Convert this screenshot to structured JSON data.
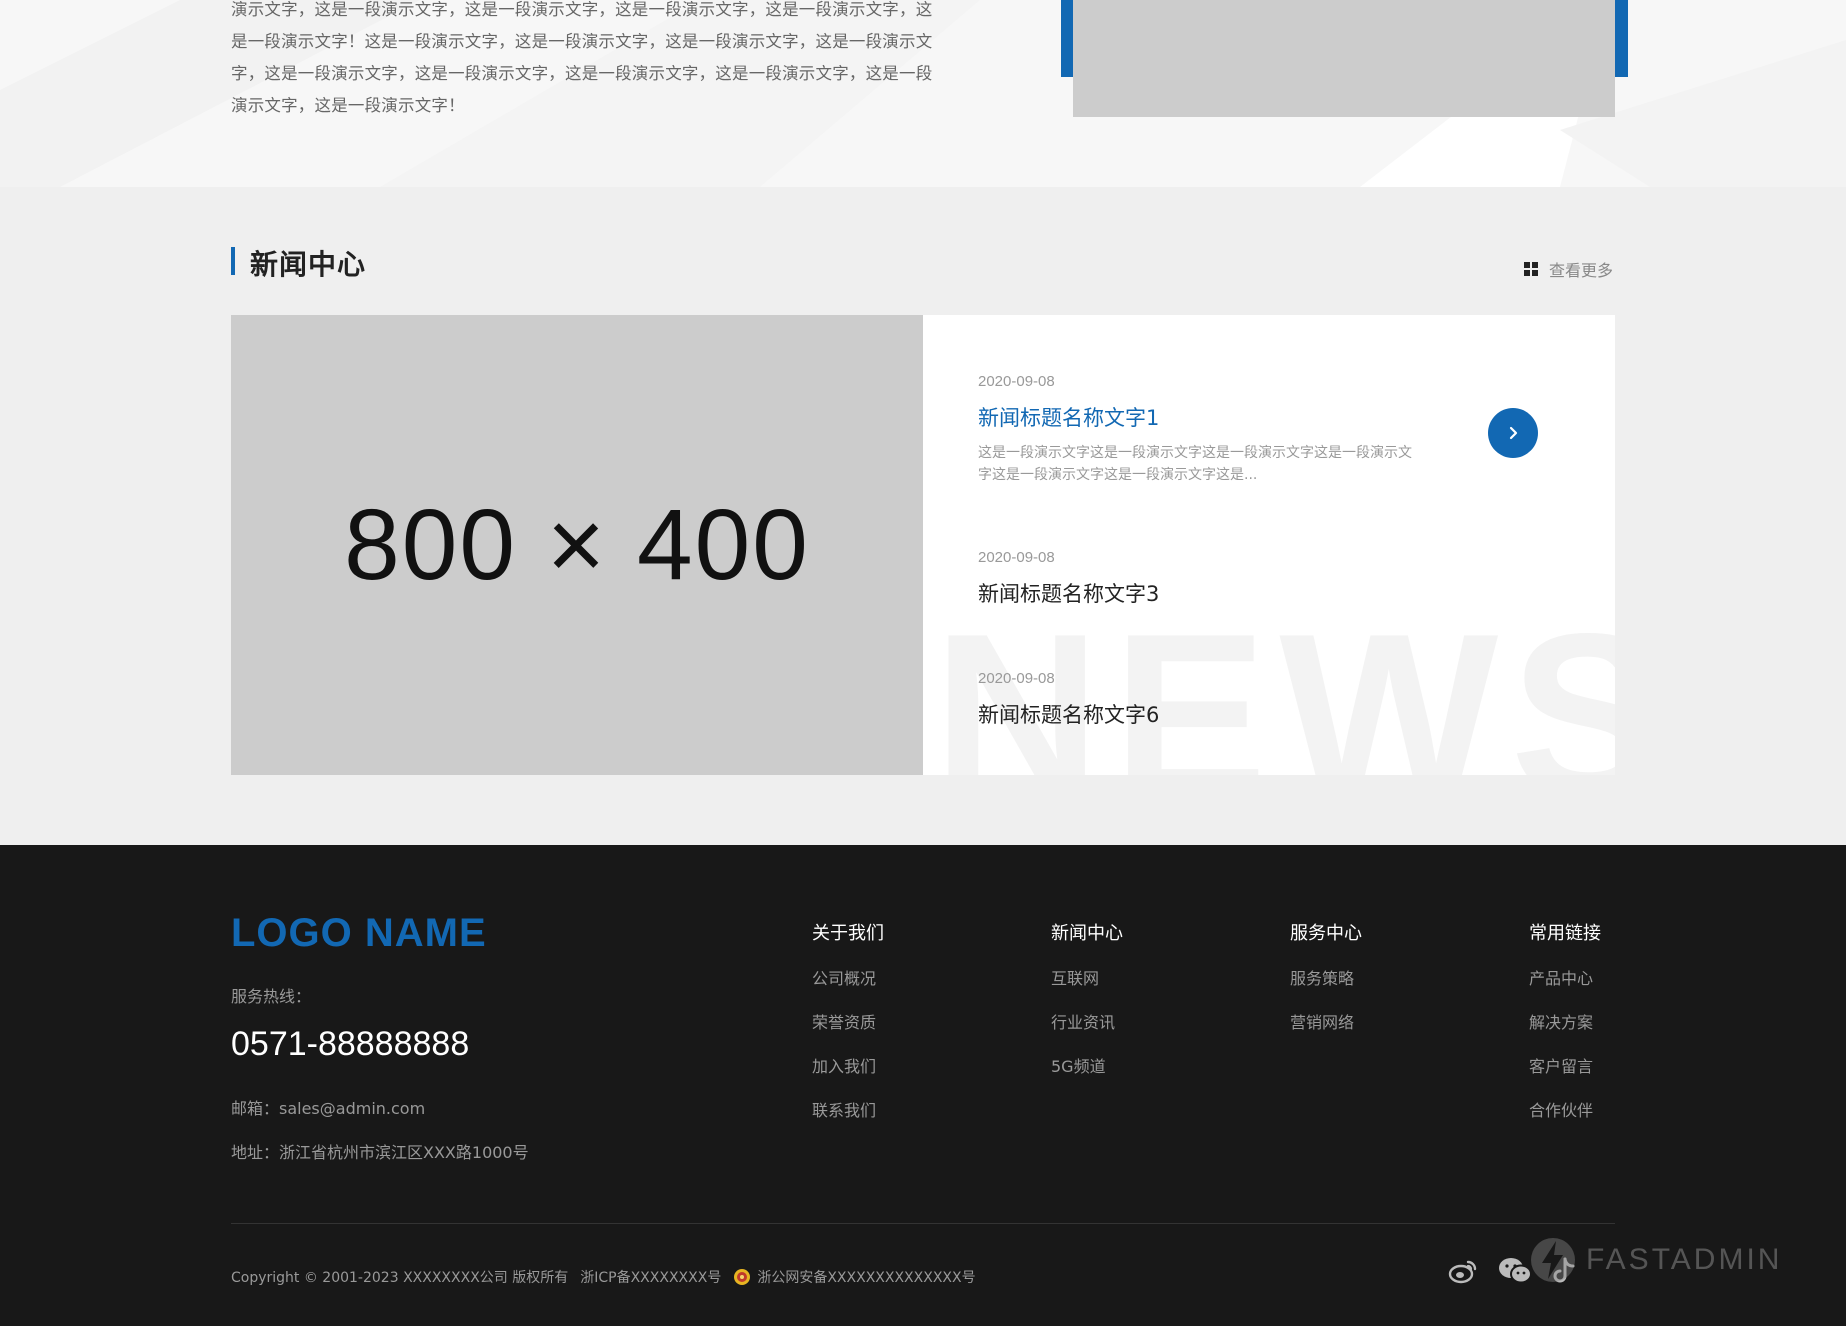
{
  "about": {
    "lines": [
      "演示文字，这是一段演示文字，这是一段演示文字，这是一段演示文字，这是一段演示文字，这",
      "是一段演示文字！这是一段演示文字，这是一段演示文字，这是一段演示文字，这是一段演示文",
      "字，这是一段演示文字，这是一段演示文字，这是一段演示文字，这是一段演示文字，这是一段",
      "演示文字，这是一段演示文字！"
    ],
    "image_color": "#cccccc",
    "image_frame_color": "#1268b3"
  },
  "news": {
    "title": "新闻中心",
    "more_label": "查看更多",
    "more_icon": "grid-icon",
    "image_label": "800 × 400",
    "watermark": "NEWS",
    "items": [
      {
        "date": "2020-09-08",
        "title": "新闻标题名称文字1",
        "desc": "这是一段演示文字这是一段演示文字这是一段演示文字这是一段演示文字这是一段演示文字这是一段演示文字这是...",
        "active": true
      },
      {
        "date": "2020-09-08",
        "title": "新闻标题名称文字3"
      },
      {
        "date": "2020-09-08",
        "title": "新闻标题名称文字6"
      }
    ],
    "arrow_icon": "chevron-right-icon",
    "accent_color": "#1268b3"
  },
  "footer": {
    "logo": "LOGO NAME",
    "hotline_label": "服务热线：",
    "hotline": "0571-88888888",
    "email": "邮箱：sales@admin.com",
    "address": "地址：浙江省杭州市滨江区XXX路1000号",
    "columns": [
      {
        "title": "关于我们",
        "links": [
          "公司概况",
          "荣誉资质",
          "加入我们",
          "联系我们"
        ]
      },
      {
        "title": "新闻中心",
        "links": [
          "互联网",
          "行业资讯",
          "5G频道"
        ]
      },
      {
        "title": "服务中心",
        "links": [
          "服务策略",
          "营销网络"
        ]
      },
      {
        "title": "常用链接",
        "links": [
          "产品中心",
          "解决方案",
          "客户留言",
          "合作伙伴"
        ]
      }
    ],
    "copyright": "Copyright © 2001-2023 XXXXXXXX公司 版权所有",
    "icp": "浙ICP备XXXXXXXX号",
    "police": "浙公网安备XXXXXXXXXXXXXX号",
    "social_icons": [
      "weibo-icon",
      "wechat-icon",
      "douyin-icon"
    ],
    "watermark_brand": "FASTADMIN",
    "background_color": "#181818"
  }
}
